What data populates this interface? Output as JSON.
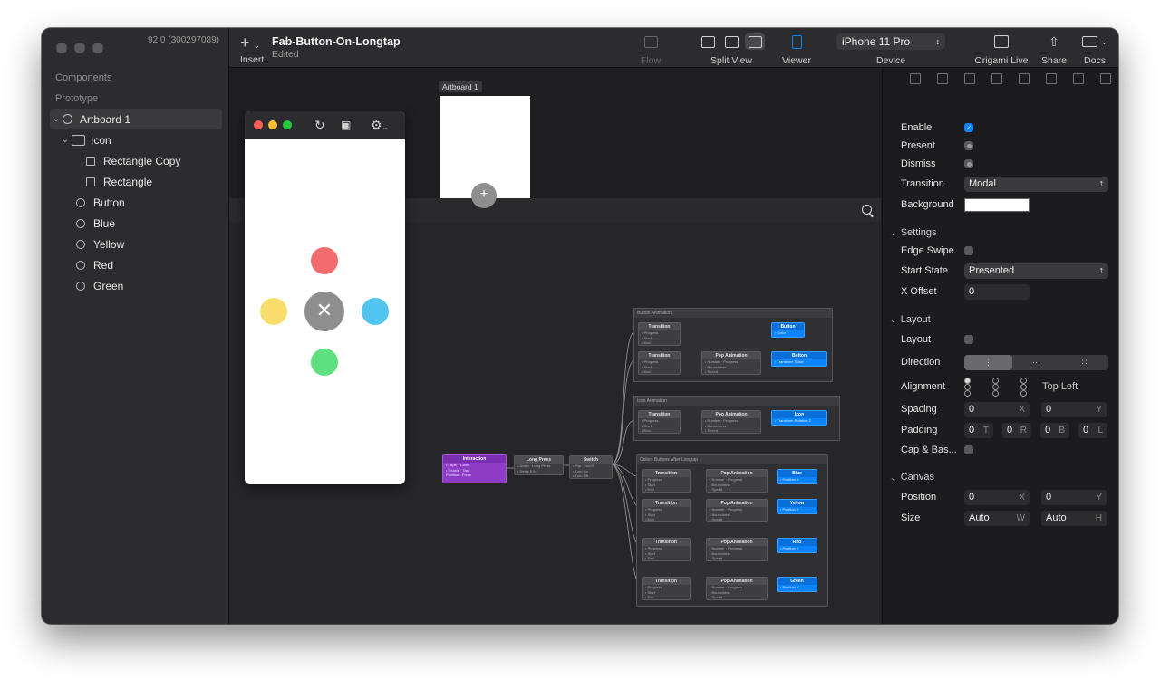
{
  "app": {
    "build": "92.0 (300297089)",
    "doc_title": "Fab-Button-On-Longtap",
    "doc_status": "Edited"
  },
  "sidebar": {
    "components_label": "Components",
    "prototype_label": "Prototype",
    "layers": [
      {
        "label": "Artboard 1"
      },
      {
        "label": "Icon"
      },
      {
        "label": "Rectangle Copy"
      },
      {
        "label": "Rectangle"
      },
      {
        "label": "Button"
      },
      {
        "label": "Blue"
      },
      {
        "label": "Yellow"
      },
      {
        "label": "Red"
      },
      {
        "label": "Green"
      }
    ]
  },
  "toolbar": {
    "insert_label": "Insert",
    "flow_label": "Flow",
    "split_view_label": "Split View",
    "viewer_label": "Viewer",
    "device_label": "Device",
    "device_value": "iPhone 11 Pro",
    "origami_live_label": "Origami Live",
    "share_label": "Share",
    "docs_label": "Docs"
  },
  "canvas": {
    "artboard_label": "Artboard 1",
    "groups": {
      "button_animation": "Button Animation",
      "icon_animation": "Icon Animation",
      "colors_after_longtap": "Colors Buttons After Longtap"
    },
    "patches": {
      "interaction": "Interaction",
      "long_press": "Long Press",
      "switch": "Switch",
      "transition": "Transition",
      "pop_animation": "Pop Animation",
      "button": "Button",
      "icon": "Icon",
      "blue": "Blue",
      "yellow": "Yellow",
      "red": "Red",
      "green": "Green"
    },
    "viewer_dots": {
      "red": "#f16b6f",
      "yellow": "#f7dd6b",
      "blue": "#52c5ee",
      "green": "#5fe07f",
      "center": "#8e8e8e"
    }
  },
  "inspector": {
    "enable": {
      "label": "Enable",
      "checked": true
    },
    "present": {
      "label": "Present"
    },
    "dismiss": {
      "label": "Dismiss"
    },
    "transition": {
      "label": "Transition",
      "value": "Modal"
    },
    "background": {
      "label": "Background",
      "color": "#ffffff"
    },
    "settings_section": "Settings",
    "edge_swipe": {
      "label": "Edge Swipe"
    },
    "start_state": {
      "label": "Start State",
      "value": "Presented"
    },
    "x_offset": {
      "label": "X Offset",
      "value": "0"
    },
    "layout_section": "Layout",
    "layout": {
      "label": "Layout"
    },
    "direction": {
      "label": "Direction"
    },
    "alignment": {
      "label": "Alignment",
      "value": "Top Left"
    },
    "spacing": {
      "label": "Spacing",
      "x": "0",
      "y": "0",
      "x_unit": "X",
      "y_unit": "Y"
    },
    "padding": {
      "label": "Padding",
      "t": "0",
      "r": "0",
      "b": "0",
      "l": "0",
      "t_unit": "T",
      "r_unit": "R",
      "b_unit": "B",
      "l_unit": "L"
    },
    "cap_baseline": {
      "label": "Cap & Bas..."
    },
    "canvas_section": "Canvas",
    "position": {
      "label": "Position",
      "x": "0",
      "y": "0",
      "x_unit": "X",
      "y_unit": "Y"
    },
    "size": {
      "label": "Size",
      "w": "Auto",
      "h": "Auto",
      "w_unit": "W",
      "h_unit": "H"
    }
  }
}
